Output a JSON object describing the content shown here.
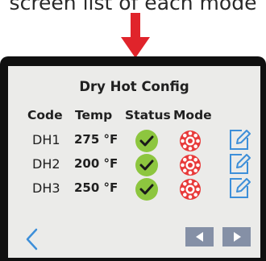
{
  "caption": "screen list of each mode",
  "screen": {
    "title": "Dry Hot Config",
    "headers": {
      "code": "Code",
      "temp": "Temp",
      "status": "Status",
      "mode": "Mode"
    },
    "rows": [
      {
        "code": "DH1",
        "temp": "275 °F"
      },
      {
        "code": "DH2",
        "temp": "200 °F"
      },
      {
        "code": "DH3",
        "temp": "250 °F"
      }
    ]
  },
  "icons": {
    "status": "check-circle-icon",
    "mode": "dry-hot-mode-icon",
    "edit": "edit-pencil-icon",
    "back": "chevron-left-icon",
    "prev": "previous-page-icon",
    "next": "next-page-icon"
  },
  "colors": {
    "arrow": "#e0242b",
    "status_green": "#8dc63f",
    "mode_red": "#e83a3a",
    "edit_blue": "#3d8fd9",
    "nav_button": "#8590a6",
    "screen_bg": "#ebebe9"
  }
}
